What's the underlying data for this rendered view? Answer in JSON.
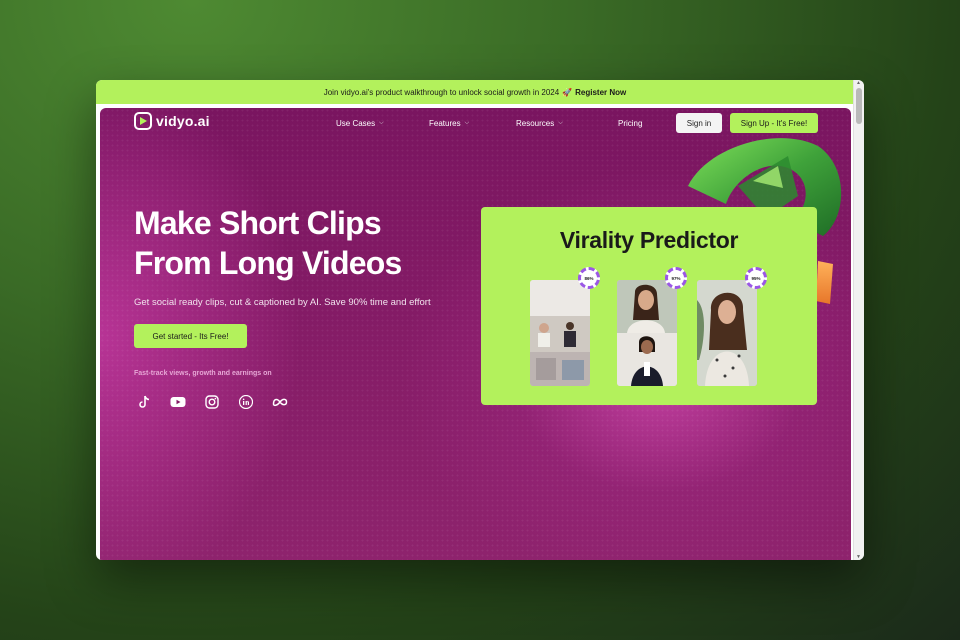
{
  "announcement": {
    "text": "Join vidyo.ai's product walkthrough to unlock social growth in 2024",
    "emoji": "🚀",
    "link": "Register Now"
  },
  "brand": {
    "name": "vidyo.ai",
    "accent": "#b3f15c",
    "background": "#841b66"
  },
  "nav": {
    "items": [
      {
        "label": "Use Cases",
        "dropdown": true
      },
      {
        "label": "Features",
        "dropdown": true
      },
      {
        "label": "Resources",
        "dropdown": true
      },
      {
        "label": "Pricing",
        "dropdown": false
      }
    ],
    "signin": "Sign in",
    "signup": "Sign Up - It's Free!"
  },
  "hero": {
    "title_line1": "Make Short Clips",
    "title_line2": "From Long Videos",
    "subtitle": "Get social ready clips, cut & captioned by AI. Save 90% time and effort",
    "cta": "Get started - Its Free!",
    "fasttrack": "Fast-track views, growth and earnings on",
    "socials": [
      "tiktok-icon",
      "youtube-icon",
      "instagram-icon",
      "linkedin-icon",
      "meta-icon"
    ]
  },
  "predictor": {
    "title": "Virality Predictor",
    "clips": [
      {
        "score": "86%"
      },
      {
        "score": "97%"
      },
      {
        "score": "95%"
      }
    ]
  }
}
